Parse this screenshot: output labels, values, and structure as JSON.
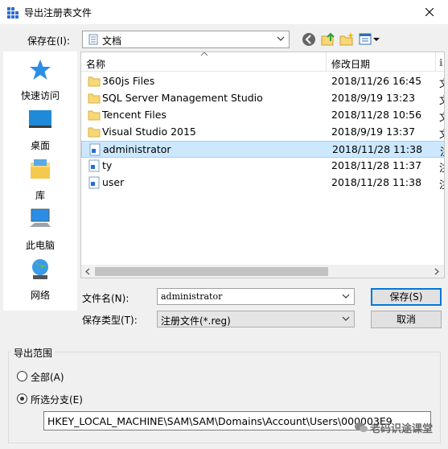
{
  "window": {
    "title": "导出注册表文件"
  },
  "savein": {
    "label": "保存在(I):",
    "value": "文档"
  },
  "places": [
    {
      "label": "快速访问",
      "icon": "star-icon"
    },
    {
      "label": "桌面",
      "icon": "desktop-icon"
    },
    {
      "label": "库",
      "icon": "library-icon"
    },
    {
      "label": "此电脑",
      "icon": "computer-icon"
    },
    {
      "label": "网络",
      "icon": "network-icon"
    }
  ],
  "filelist": {
    "headers": {
      "name": "名称",
      "date": "修改日期"
    },
    "rows": [
      {
        "name": "360js Files",
        "date": "2018/11/26 16:45",
        "type": "文",
        "kind": "folder"
      },
      {
        "name": "SQL Server Management Studio",
        "date": "2018/9/19 13:23",
        "type": "文",
        "kind": "folder"
      },
      {
        "name": "Tencent Files",
        "date": "2018/11/28 10:56",
        "type": "文",
        "kind": "folder"
      },
      {
        "name": "Visual Studio 2015",
        "date": "2018/9/19 13:37",
        "type": "文",
        "kind": "folder"
      },
      {
        "name": "administrator",
        "date": "2018/11/28 11:38",
        "type": "注",
        "kind": "reg",
        "selected": true
      },
      {
        "name": "ty",
        "date": "2018/11/28 11:37",
        "type": "注",
        "kind": "reg"
      },
      {
        "name": "user",
        "date": "2018/11/28 11:38",
        "type": "注",
        "kind": "reg"
      }
    ]
  },
  "filename": {
    "label": "文件名(N):",
    "value": "administrator"
  },
  "filetype": {
    "label": "保存类型(T):",
    "value": "注册文件(*.reg)"
  },
  "buttons": {
    "save": "保存(S)",
    "cancel": "取消"
  },
  "export_range": {
    "title": "导出范围",
    "all_label": "全部(A)",
    "branch_label": "所选分支(E)",
    "selected": "branch",
    "branch_value": "HKEY_LOCAL_MACHINE\\SAM\\SAM\\Domains\\Account\\Users\\000003E9"
  },
  "watermark": "老码识途课堂",
  "colors": {
    "selection": "#cce8ff",
    "accent": "#0078d7",
    "folder": "#f8d775"
  }
}
